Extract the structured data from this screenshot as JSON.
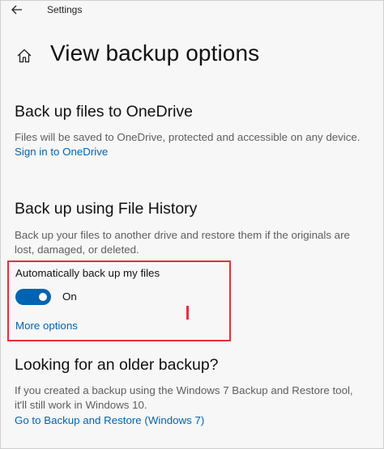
{
  "window": {
    "title": "Settings"
  },
  "page": {
    "title": "View backup options"
  },
  "onedrive": {
    "heading": "Back up files to OneDrive",
    "description": "Files will be saved to OneDrive, protected and accessible on any device.",
    "link": "Sign in to OneDrive"
  },
  "file_history": {
    "heading": "Back up using File History",
    "description_line1": "Back up your files to another drive and restore them if the originals are",
    "description_line2": "lost, damaged, or deleted.",
    "auto_label": "Automatically back up my files",
    "toggle_state": "On",
    "more_options": "More options"
  },
  "older_backup": {
    "heading": "Looking for an older backup?",
    "description_line1": "If you created a backup using the Windows 7 Backup and Restore tool,",
    "description_line2": "it'll still work in Windows 10.",
    "link": "Go to Backup and Restore (Windows 7)"
  },
  "colors": {
    "accent": "#0063b1",
    "highlight": "#e5303a"
  },
  "icons": {
    "back": "back-arrow-icon",
    "home": "home-icon"
  }
}
